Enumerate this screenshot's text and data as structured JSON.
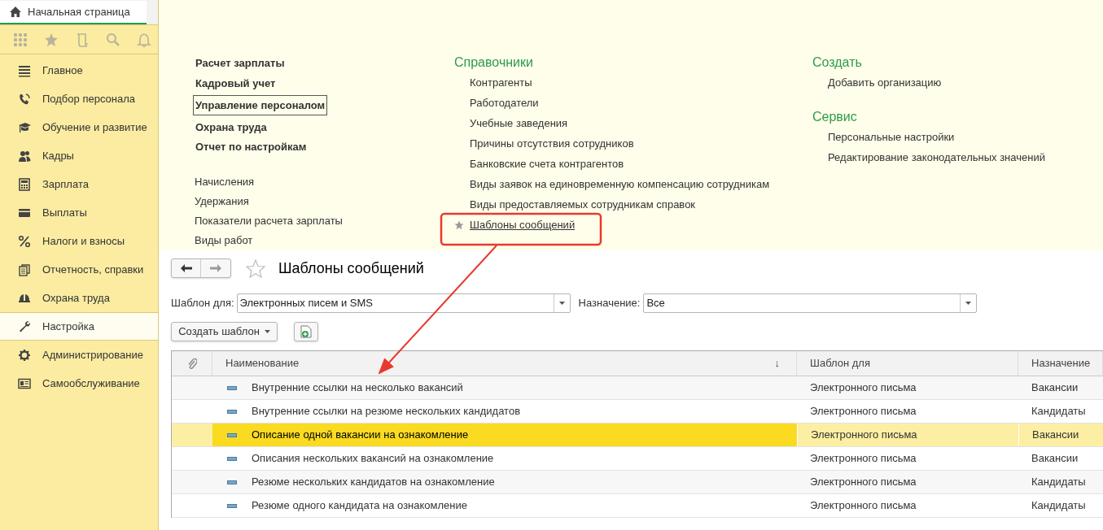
{
  "tabs": [
    {
      "label": "Начальная страница",
      "selected": true
    }
  ],
  "sidebar": {
    "items": [
      {
        "label": "Главное",
        "selected": false
      },
      {
        "label": "Подбор персонала",
        "selected": false
      },
      {
        "label": "Обучение и развитие",
        "selected": false
      },
      {
        "label": "Кадры",
        "selected": false
      },
      {
        "label": "Зарплата",
        "selected": false
      },
      {
        "label": "Выплаты",
        "selected": false
      },
      {
        "label": "Налоги и взносы",
        "selected": false
      },
      {
        "label": "Отчетность, справки",
        "selected": false
      },
      {
        "label": "Охрана труда",
        "selected": false
      },
      {
        "label": "Настройка",
        "selected": true
      },
      {
        "label": "Администрирование",
        "selected": false
      },
      {
        "label": "Самообслуживание",
        "selected": false
      }
    ]
  },
  "section_panel": {
    "main_commands": [
      {
        "label": "Расчет зарплаты",
        "focused": false
      },
      {
        "label": "Кадровый учет",
        "focused": false
      },
      {
        "label": "Управление персоналом",
        "focused": true
      },
      {
        "label": "Охрана труда",
        "focused": false
      },
      {
        "label": "Отчет по настройкам",
        "focused": false
      }
    ],
    "more_commands": [
      "Начисления",
      "Удержания",
      "Показатели расчета зарплаты",
      "Виды работ"
    ],
    "columns": [
      [
        {
          "title": "Справочники",
          "items": [
            {
              "label": "Контрагенты",
              "favorite": false
            },
            {
              "label": "Работодатели",
              "favorite": false
            },
            {
              "label": "Учебные заведения",
              "favorite": false
            },
            {
              "label": "Причины отсутствия сотрудников",
              "favorite": false
            },
            {
              "label": "Банковские счета контрагентов",
              "favorite": false
            },
            {
              "label": "Виды заявок на единовременную компенсацию сотрудникам",
              "favorite": false
            },
            {
              "label": "Виды предоставляемых сотрудникам справок",
              "favorite": false
            },
            {
              "label": "Шаблоны сообщений",
              "favorite": true
            }
          ]
        }
      ],
      [
        {
          "title": "Создать",
          "items": [
            {
              "label": "Добавить организацию",
              "favorite": false
            }
          ]
        },
        {
          "title": "Сервис",
          "items": [
            {
              "label": "Персональные настройки",
              "favorite": false
            },
            {
              "label": "Редактирование законодательных значений",
              "favorite": false
            }
          ]
        }
      ]
    ]
  },
  "form": {
    "title": "Шаблоны сообщений",
    "filters": [
      {
        "label": "Шаблон для:",
        "value": "Электронных писем и SMS"
      },
      {
        "label": "Назначение:",
        "value": "Все"
      }
    ],
    "create_button": "Создать шаблон",
    "table": {
      "columns": [
        "Наименование",
        "Шаблон для",
        "Назначение"
      ],
      "sort_mark": "↓",
      "rows": [
        {
          "name": "Внутренние ссылки на несколько вакансий",
          "template_for": "Электронного письма",
          "purpose": "Вакансии",
          "selected": false
        },
        {
          "name": "Внутренние ссылки на резюме нескольких кандидатов",
          "template_for": "Электронного письма",
          "purpose": "Кандидаты",
          "selected": false
        },
        {
          "name": "Описание одной вакансии на ознакомление",
          "template_for": "Электронного письма",
          "purpose": "Вакансии",
          "selected": true
        },
        {
          "name": "Описания нескольких вакансий на ознакомление",
          "template_for": "Электронного письма",
          "purpose": "Вакансии",
          "selected": false
        },
        {
          "name": "Резюме нескольких кандидатов на ознакомление",
          "template_for": "Электронного письма",
          "purpose": "Кандидаты",
          "selected": false
        },
        {
          "name": "Резюме одного кандидата на ознакомление",
          "template_for": "Электронного письма",
          "purpose": "Кандидаты",
          "selected": false
        }
      ]
    }
  }
}
